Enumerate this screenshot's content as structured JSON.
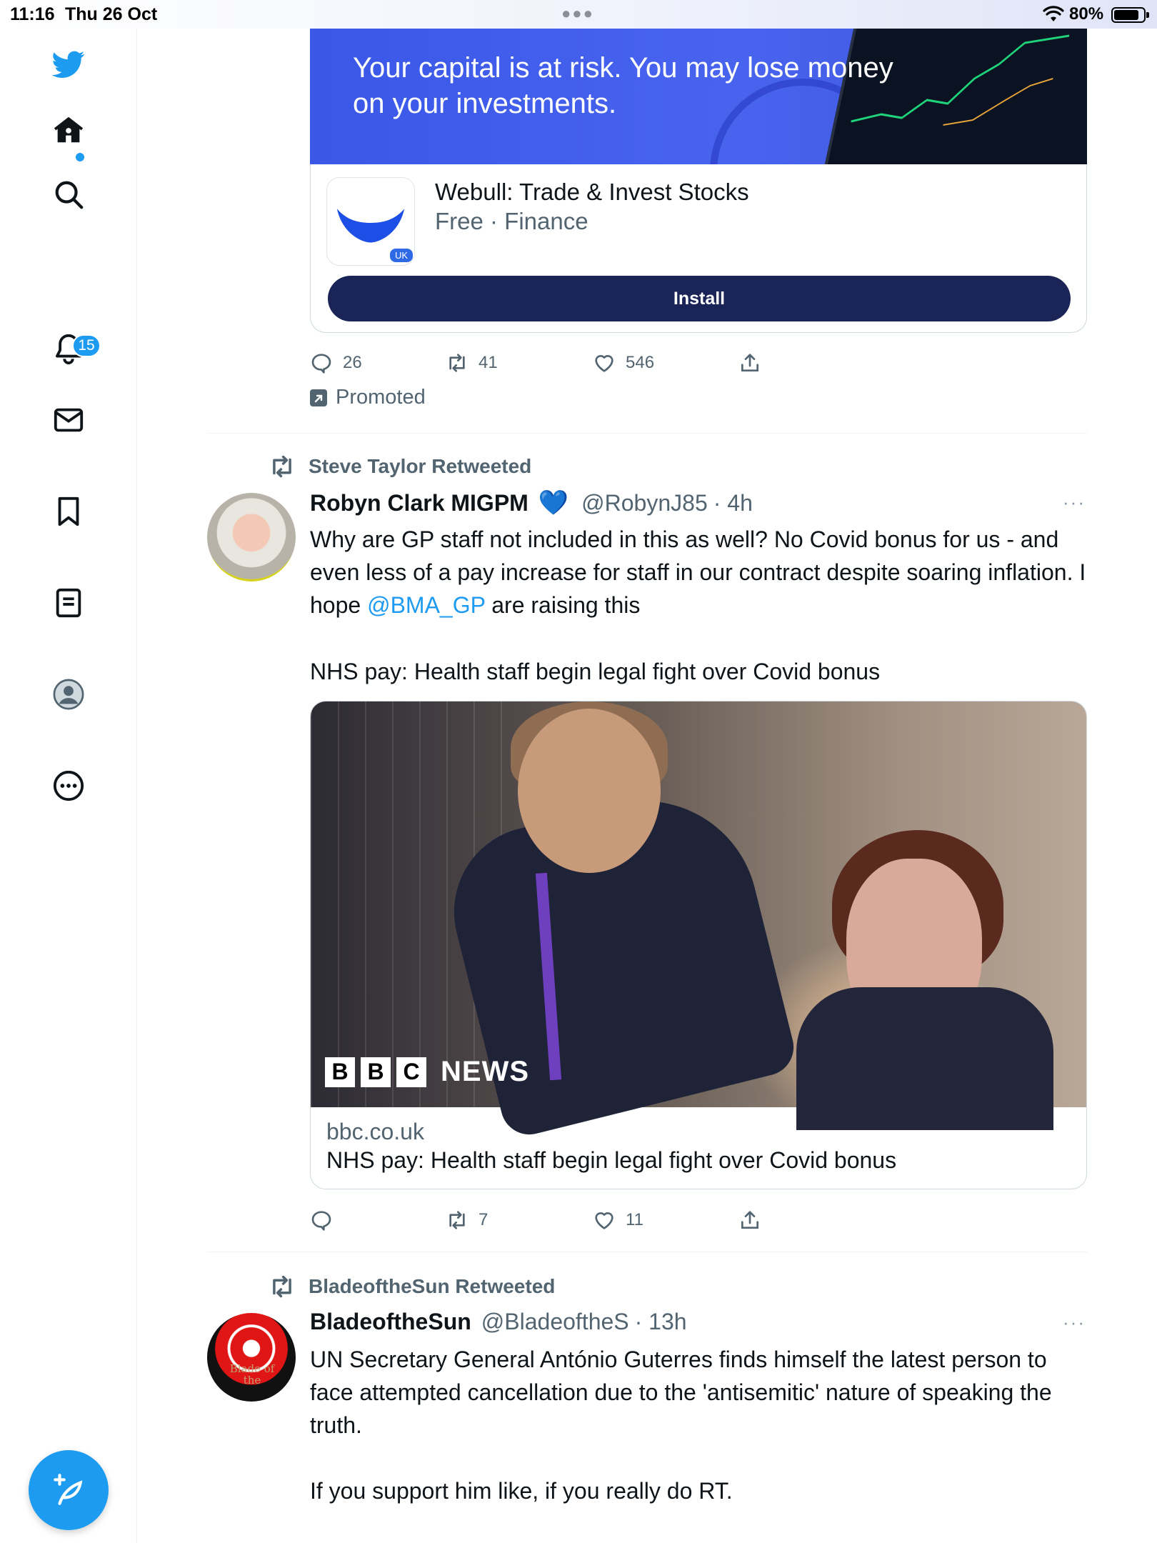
{
  "status_bar": {
    "time": "11:16",
    "date": "Thu 26 Oct",
    "battery": "80%"
  },
  "sidebar": {
    "notifications_badge": "15",
    "items": [
      "twitter-logo",
      "home",
      "search",
      "notifications",
      "messages",
      "bookmarks",
      "lists",
      "profile",
      "more"
    ]
  },
  "ad": {
    "banner_text_line1": "Your capital is at risk. You may lose money",
    "banner_text_line2": "on your investments.",
    "app_name": "Webull: Trade & Invest Stocks",
    "app_meta": "Free · Finance",
    "app_badge": "UK",
    "install_label": "Install",
    "replies": "26",
    "retweets": "41",
    "likes": "546",
    "promoted_label": "Promoted"
  },
  "tweet1": {
    "retweeted_by": "Steve Taylor Retweeted",
    "name": "Robyn Clark MIGPM",
    "heart_emoji": "💙",
    "handle": "@RobynJ85",
    "time": "· 4h",
    "more": "···",
    "text_part1": "Why are GP staff not included in this as well? No Covid bonus for us - and even less of a pay increase for staff in our contract despite soaring inflation. I hope ",
    "mention": "@BMA_GP",
    "text_part2": " are raising this",
    "text_line2": "NHS pay: Health staff begin legal fight over Covid bonus",
    "card": {
      "logo_b1": "B",
      "logo_b2": "B",
      "logo_c": "C",
      "logo_news": "NEWS",
      "domain": "bbc.co.uk",
      "title": "NHS pay: Health staff begin legal fight over Covid bonus"
    },
    "retweets": "7",
    "likes": "11"
  },
  "tweet2": {
    "retweeted_by": "BladeoftheSun Retweeted",
    "name": "BladeoftheSun",
    "handle": "@BladeoftheS",
    "time": "· 13h",
    "more": "···",
    "text": "UN Secretary General António Guterres finds himself the latest person to face attempted cancellation due to the 'antisemitic' nature of speaking the truth.",
    "text_line2": "If you support him like, if you really do RT.",
    "avatar_text": "Blade of the"
  },
  "colors": {
    "accent": "#1d9bf0",
    "install_button": "#1b2456",
    "secondary_text": "#536471"
  }
}
